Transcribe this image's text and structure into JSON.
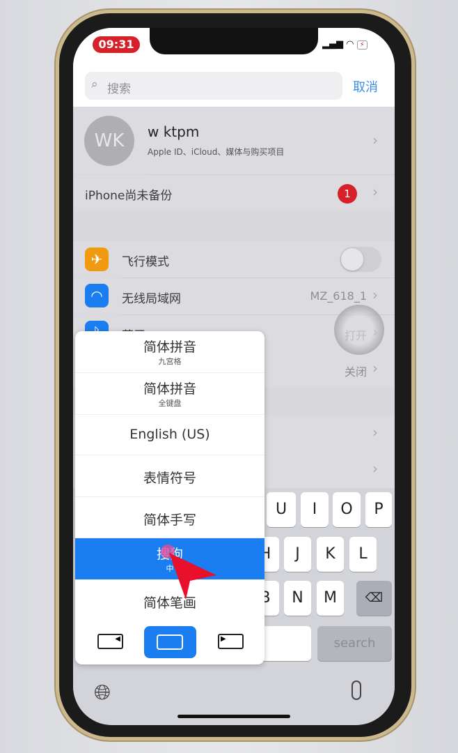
{
  "status": {
    "time": "09:31"
  },
  "search": {
    "placeholder": "搜索",
    "cancel": "取消"
  },
  "profile": {
    "initials": "WK",
    "name": "w ktpm",
    "subtitle": "Apple ID、iCloud、媒体与购买项目"
  },
  "backup": {
    "label": "iPhone尚未备份",
    "badge": "1"
  },
  "settings": [
    {
      "label": "飞行模式",
      "icon": "airplane-icon",
      "color": "#f09a0f",
      "toggle": false
    },
    {
      "label": "无线局域网",
      "icon": "wifi-icon",
      "color": "#1a7ef0",
      "value": "MZ_618_1"
    },
    {
      "label": "蓝牙",
      "icon": "bluetooth-icon",
      "color": "#1a7ef0",
      "value": "打开"
    },
    {
      "value": "关闭"
    }
  ],
  "keyboard": {
    "row1": [
      "U",
      "I",
      "O",
      "P"
    ],
    "row2": [
      "H",
      "J",
      "K",
      "L"
    ],
    "row3": [
      "B",
      "N",
      "M"
    ],
    "search": "search"
  },
  "popup": {
    "items": [
      {
        "main": "简体拼音",
        "sub": "九宫格"
      },
      {
        "main": "简体拼音",
        "sub": "全键盘"
      },
      {
        "main": "English (US)"
      },
      {
        "main": "表情符号"
      },
      {
        "main": "简体手写"
      },
      {
        "main": "搜狗",
        "sub": "中",
        "selected": true
      },
      {
        "main": "简体笔画"
      }
    ],
    "accent": "#1a7ef0"
  }
}
